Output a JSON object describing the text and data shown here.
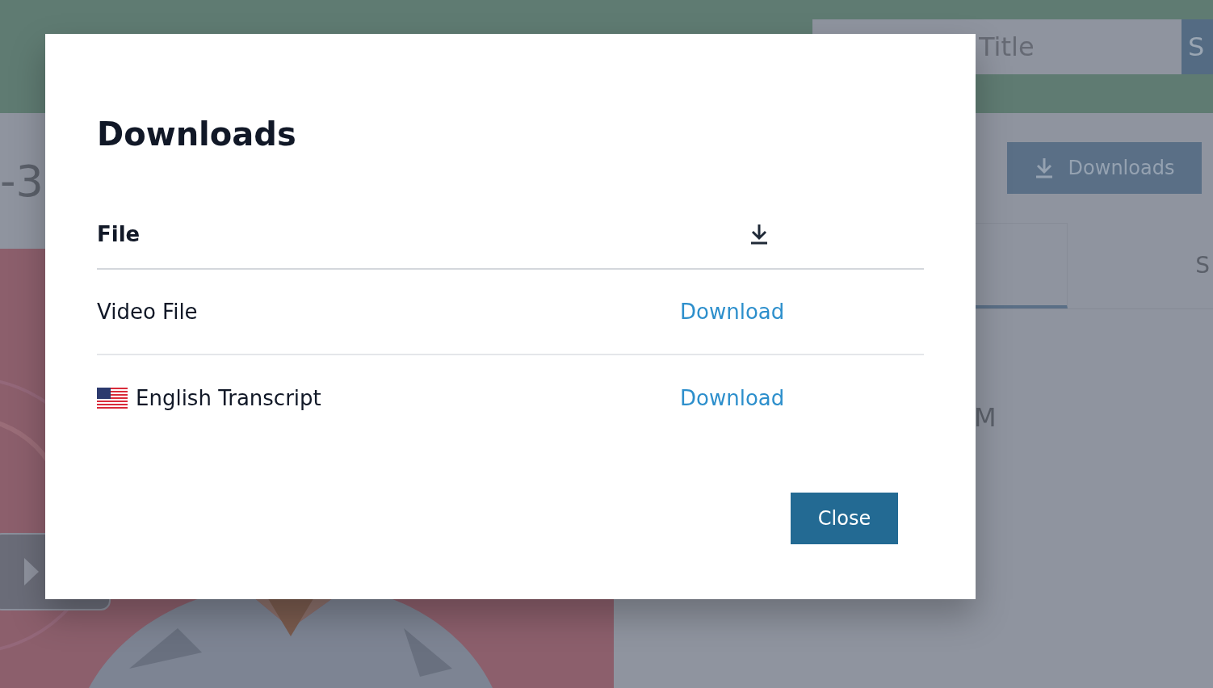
{
  "background": {
    "search_field": {
      "placeholder": "Title"
    },
    "search_button": "S",
    "heading_fragment": "-3",
    "downloads_button": "Downloads",
    "tabs": [
      {
        "selected": true
      },
      {
        "label": "S",
        "selected": false
      }
    ],
    "text_fragment": "M"
  },
  "dialog": {
    "title": "Downloads",
    "columns": [
      "File"
    ],
    "rows": [
      {
        "kind": "file",
        "name": "Video File",
        "action": "Download"
      },
      {
        "kind": "transcript",
        "name": "English Transcript",
        "action": "Download"
      }
    ],
    "close_button": "Close"
  }
}
